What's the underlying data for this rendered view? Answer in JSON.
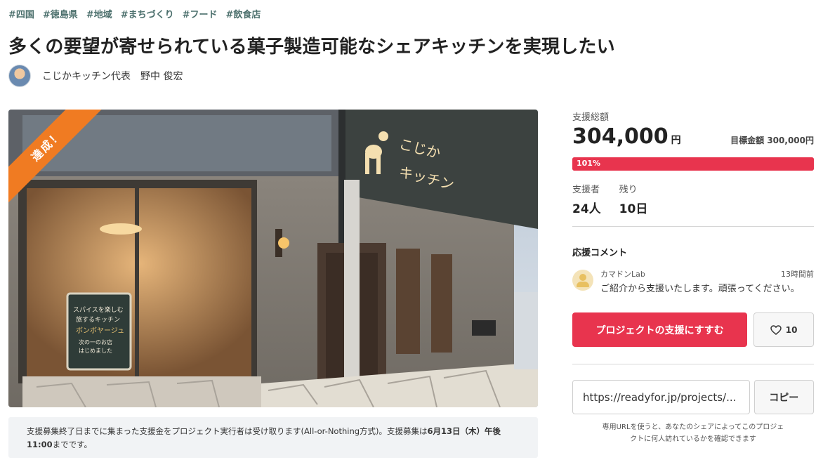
{
  "tags": [
    "#四国",
    "#徳島県",
    "#地域",
    "#まちづくり",
    "#フード",
    "#飲食店"
  ],
  "title": "多くの要望が寄せられている菓子製造可能なシェアキッチンを実現したい",
  "owner": {
    "name": "こじかキッチン代表　野中 俊宏"
  },
  "hero": {
    "ribbon": "達成！",
    "sign_text_1": "こじか",
    "sign_text_2": "キッチン",
    "board_line_1": "スパイスを楽しむ",
    "board_line_2": "旅するキッチン",
    "board_line_3": "ボンボヤージュ",
    "board_line_4": "次の一のお店",
    "board_line_5": "はじめました"
  },
  "notice": {
    "text_1": "支援募集終了日までに集まった支援金をプロジェクト実行者は受け取ります(All-or-Nothing方式)。支援募集は",
    "date": "6月13日（木）午後11:00",
    "text_2": "までです。"
  },
  "funding": {
    "total_label": "支援総額",
    "amount": "304,000",
    "unit": "円",
    "goal_label": "目標金額 300,000円",
    "percent_label": "101%",
    "percent_value": 101
  },
  "stats": {
    "backers_label": "支援者",
    "backers_value": "24人",
    "remaining_label": "残り",
    "remaining_value": "10日"
  },
  "comments": {
    "title": "応援コメント",
    "items": [
      {
        "user": "カマドンLab",
        "time": "13時間前",
        "text": "ご紹介から支援いたします。頑張ってください。"
      }
    ]
  },
  "actions": {
    "support_label": "プロジェクトの支援にすすむ",
    "favorite_count": "10"
  },
  "share": {
    "url": "https://readyfor.jp/projects/...",
    "copy_label": "コピー",
    "note_1": "専用URLを使うと、あなたのシェアによってこのプロジェ",
    "note_2": "クトに何人訪れているかを確認できます"
  },
  "colors": {
    "accent": "#e8344e",
    "ribbon": "#f07b22",
    "tag": "#4b6f6c"
  }
}
